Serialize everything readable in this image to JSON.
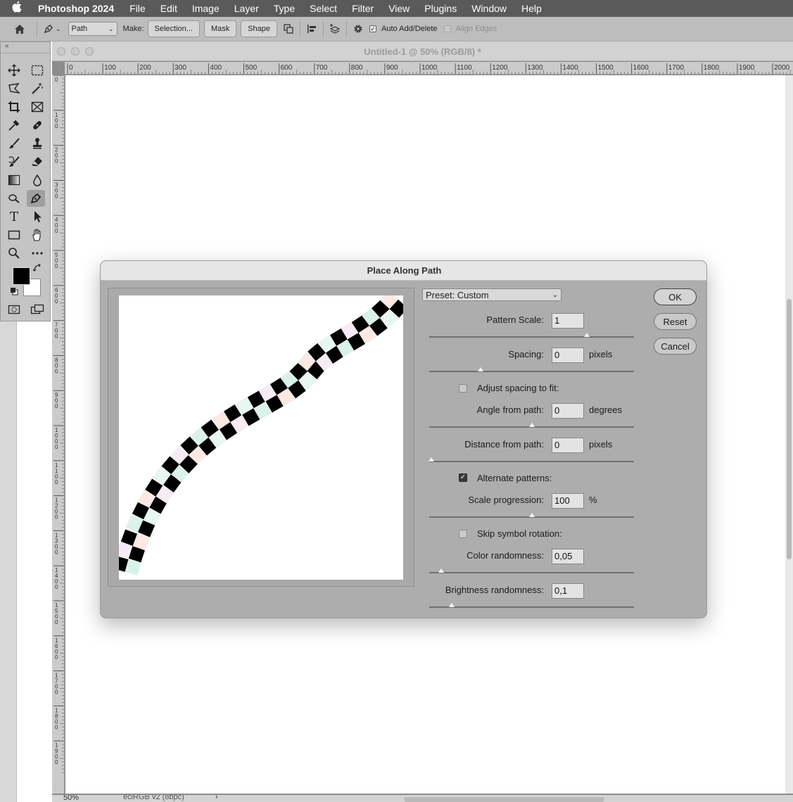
{
  "menubar": {
    "app_name": "Photoshop 2024",
    "items": [
      "File",
      "Edit",
      "Image",
      "Layer",
      "Type",
      "Select",
      "Filter",
      "View",
      "Plugins",
      "Window",
      "Help"
    ]
  },
  "options_bar": {
    "mode_select": "Path",
    "make_label": "Make:",
    "selection_button": "Selection...",
    "mask_button": "Mask",
    "shape_button": "Shape",
    "auto_add_delete_label": "Auto Add/Delete",
    "auto_add_delete_checked": true,
    "align_edges_label": "Align Edges"
  },
  "document": {
    "title": "Untitled-1 @ 50% (RGB/8) *",
    "zoom": "50%",
    "color_profile": "eciRGB v2 (8bpc)",
    "h_ruler_ticks": [
      "0",
      "100",
      "200",
      "300",
      "400",
      "500",
      "600",
      "700",
      "800",
      "900",
      "1000",
      "1100",
      "1200",
      "1300",
      "1400",
      "1500",
      "1600",
      "1700",
      "1800",
      "1900",
      "2000"
    ],
    "v_ruler_ticks": [
      "0",
      "1 0 0",
      "2 0 0",
      "3 0 0",
      "4 0 0",
      "5 0 0",
      "6 0 0",
      "7 0 0",
      "8 0 0",
      "9 0 0",
      "1 0 0 0",
      "1 1 0 0",
      "1 2 0 0",
      "1 3 0 0",
      "1 4 0 0",
      "1 5 0 0",
      "1 6 0 0",
      "1 7 0 0",
      "1 8 0 0",
      "1 9 0 0"
    ]
  },
  "dialog": {
    "title": "Place Along Path",
    "preset": "Preset: Custom",
    "buttons": {
      "ok": "OK",
      "reset": "Reset",
      "cancel": "Cancel"
    },
    "pattern_scale": {
      "label": "Pattern Scale:",
      "value": "1",
      "slider": 0.77
    },
    "spacing": {
      "label": "Spacing:",
      "value": "0",
      "unit": "pixels",
      "slider": 0.25
    },
    "adjust_spacing": {
      "label": "Adjust spacing to fit:",
      "checked": false
    },
    "angle": {
      "label": "Angle from path:",
      "value": "0",
      "unit": "degrees",
      "slider": 0.5
    },
    "distance": {
      "label": "Distance from path:",
      "value": "0",
      "unit": "pixels",
      "slider": 0.01
    },
    "alternate_patterns": {
      "label": "Alternate patterns:",
      "checked": true
    },
    "scale_progression": {
      "label": "Scale progression:",
      "value": "100",
      "unit": "%",
      "slider": 0.5
    },
    "skip_rotation": {
      "label": "Skip symbol rotation:",
      "checked": false
    },
    "color_randomness": {
      "label": "Color randomness:",
      "value": "0,05",
      "slider": 0.06
    },
    "brightness_randomness": {
      "label": "Brightness randomness:",
      "value": "0,1",
      "slider": 0.11
    }
  },
  "colors": {
    "menubar": "#5a5a5a",
    "dialog_bg": "#adadad",
    "path_blue": "#1b7fd1",
    "tile_black": "#000000"
  },
  "icons": [
    "apple-icon",
    "home-icon",
    "pen-tool-icon",
    "gear-icon",
    "move-icon",
    "marquee-icon",
    "lasso-icon",
    "magic-wand-icon",
    "crop-icon",
    "frame-icon",
    "eyedropper-icon",
    "healing-icon",
    "brush-icon",
    "stamp-icon",
    "history-brush-icon",
    "eraser-icon",
    "gradient-icon",
    "blur-icon",
    "dodge-icon",
    "type-icon",
    "path-select-icon",
    "rectangle-icon",
    "hand-icon",
    "zoom-icon",
    "more-icon",
    "swap-colors-icon",
    "quick-mask-icon",
    "screen-mode-icon"
  ]
}
